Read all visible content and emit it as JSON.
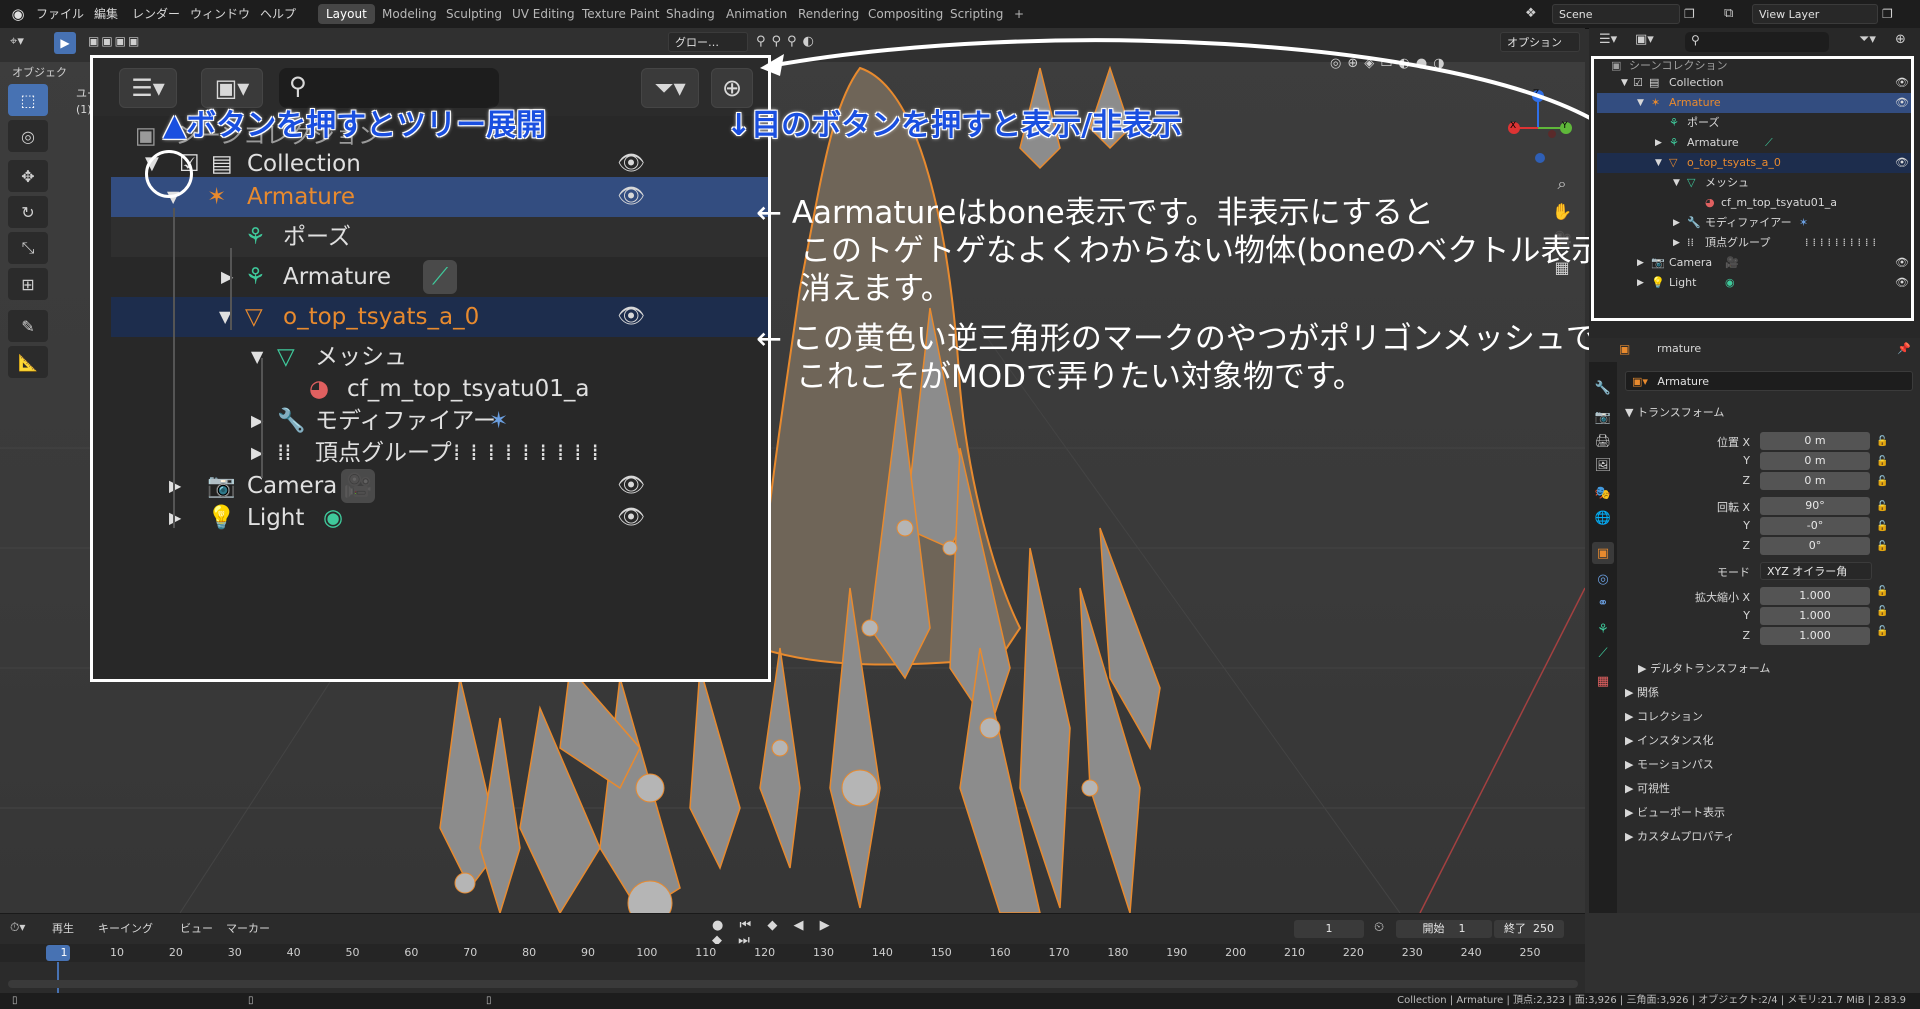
{
  "app": {
    "menus": [
      "ファイル",
      "編集",
      "レンダー",
      "ウィンドウ",
      "ヘルプ"
    ],
    "workspaces": [
      "Layout",
      "Modeling",
      "Sculpting",
      "UV Editing",
      "Texture Paint",
      "Shading",
      "Animation",
      "Rendering",
      "Compositing",
      "Scripting"
    ],
    "active_workspace": "Layout",
    "add_workspace": "+",
    "scene": "Scene",
    "view_layer": "View Layer"
  },
  "viewport_header": {
    "object_mode_label": "オブジェク",
    "orientation": "グロー…",
    "options_label": "オプション",
    "user_persp_line1": "ユー",
    "user_persp_line2": "(1)"
  },
  "gizmo": {
    "x": "X",
    "y": "Y",
    "z": "Z"
  },
  "callout": {
    "search_placeholder": "",
    "rows": [
      {
        "label": "シーンコレクション",
        "type": "scene"
      },
      {
        "label": "Collection"
      },
      {
        "label": "Armature"
      },
      {
        "label": "ポーズ"
      },
      {
        "label": "Armature"
      },
      {
        "label": "o_top_tsyats_a_0"
      },
      {
        "label": "メッシュ"
      },
      {
        "label": "cf_m_top_tsyatu01_a"
      },
      {
        "label": "モディファイアー"
      },
      {
        "label": "頂点グループ"
      },
      {
        "label": "Camera"
      },
      {
        "label": "Light"
      }
    ]
  },
  "notes": {
    "tree_expand": "▲ボタンを押すとツリー展開",
    "eye_toggle": "↓目のボタンを押すと表示/非表示",
    "armature_line1": "← Aarmatureはbone表示です。非表示にすると",
    "armature_line2": "このトゲトゲなよくわからない物体(boneのベクトル表示？)が",
    "armature_line3": "消えます。",
    "mesh_line1": "← この黄色い逆三角形のマークのやつがポリゴンメッシュです。",
    "mesh_line2": "これこそがMODで弄りたい対象物です。"
  },
  "outliner": {
    "rows": [
      {
        "label": "シーンコレクション"
      },
      {
        "label": "Collection"
      },
      {
        "label": "Armature"
      },
      {
        "label": "ポーズ"
      },
      {
        "label": "Armature"
      },
      {
        "label": "o_top_tsyats_a_0"
      },
      {
        "label": "メッシュ"
      },
      {
        "label": "cf_m_top_tsyatu01_a"
      },
      {
        "label": "モディファイアー"
      },
      {
        "label": "頂点グループ"
      },
      {
        "label": "Camera"
      },
      {
        "label": "Light"
      }
    ]
  },
  "properties": {
    "header_name": "rmature",
    "object_name": "Armature",
    "transform_title": "トランスフォーム",
    "location_label": "位置 X",
    "location": [
      "0 m",
      "0 m",
      "0 m"
    ],
    "rotation_label": "回転 X",
    "rotation": [
      "90°",
      "-0°",
      "0°"
    ],
    "mode_label": "モード",
    "mode_value": "XYZ オイラー角",
    "scale_label": "拡大縮小 X",
    "scale": [
      "1.000",
      "1.000",
      "1.000"
    ],
    "axis_y": "Y",
    "axis_z": "Z",
    "sections": [
      "デルタトランスフォーム",
      "関係",
      "コレクション",
      "インスタンス化",
      "モーションパス",
      "可視性",
      "ビューポート表示",
      "カスタムプロパティ"
    ]
  },
  "timeline": {
    "menus": [
      "再生",
      "キーイング",
      "ビュー",
      "マーカー"
    ],
    "current_frame": "1",
    "start_label": "開始",
    "start": "1",
    "end_label": "終了",
    "end": "250",
    "ticks": [
      "1",
      "10",
      "20",
      "30",
      "40",
      "50",
      "60",
      "70",
      "80",
      "90",
      "100",
      "110",
      "120",
      "130",
      "140",
      "150",
      "160",
      "170",
      "180",
      "190",
      "200",
      "210",
      "220",
      "230",
      "240",
      "250"
    ]
  },
  "status": {
    "text": "Collection | Armature | 頂点:2,323 | 面:3,926 | 三角面:3,926 | オブジェクト:2/4 | メモリ:21.7 MiB | 2.83.9"
  },
  "colors": {
    "accent": "#4772b3",
    "selected_row": "#334d80",
    "orange": "#e88a2e",
    "mesh_green": "#3fc99b",
    "note_blue": "#1a4fe0"
  }
}
